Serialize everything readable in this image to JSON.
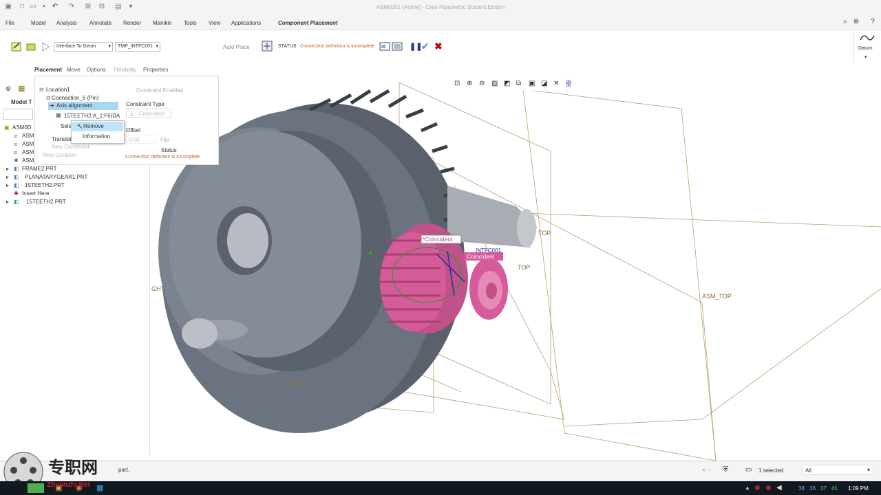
{
  "window": {
    "title": "ASM0001 (Active) - Creo Parametric Student Edition"
  },
  "menu": {
    "items": [
      "File",
      "Model",
      "Analysis",
      "Annotate",
      "Render",
      "Manikin",
      "Tools",
      "View",
      "Applications"
    ],
    "active": "Component Placement"
  },
  "ribbon": {
    "interface_dropdown": "Interface To Geom",
    "interface_value": "TMP_INTFC001",
    "auto_place": "Auto Place",
    "status_label": "STATUS",
    "status_text": "Connection definition is incomplete",
    "datum_label": "Datum"
  },
  "tabs": [
    "Placement",
    "Move",
    "Options",
    "Flexibility",
    "Properties"
  ],
  "panel": {
    "location": "Location1",
    "connection": "Connection_6 (Pin)",
    "axis_alignment": "Axis alignment",
    "reference": "15TEETH2:A_1:F6(DA",
    "select": "Sele",
    "translation": "Translati",
    "new_constraint": "New Constraint",
    "new_location": "New Location",
    "constraint_enabled": "Constraint Enabled",
    "constraint_type_label": "Constraint Type",
    "constraint_type_value": "Coincident",
    "offset_label": "Offset",
    "offset_value": "0.00",
    "flip": "Flip",
    "status_label": "Status",
    "status_text": "Connection definition is incomplete"
  },
  "context_menu": {
    "remove": "Remove",
    "information": "Information"
  },
  "tree": {
    "model_tab": "Model T",
    "root": "ASM0D",
    "items": [
      "ASM",
      "ASM",
      "ASM",
      "ASM"
    ],
    "parts": [
      "FRAME2.PRT",
      "PLANATARYGEAR1.PRT",
      "15TEETH2.PRT",
      "Insert Here",
      "15TEETH2.PRT"
    ]
  },
  "viewport": {
    "labels": {
      "top1": "TOP",
      "top2": "TOP",
      "asm_top": "ASM_TOP",
      "right1": "RIGHT",
      "right2": "GHT",
      "coincident1": "*Coincident",
      "coincident2": "Coincident",
      "intfc": "INTFC001"
    }
  },
  "statusbar": {
    "message": "part.",
    "selected": "1 selected",
    "filter": "All"
  },
  "taskbar": {
    "time": "1:09 PM",
    "nums": [
      "38",
      "36",
      "37",
      "41"
    ]
  },
  "watermark": {
    "brand": "专职网",
    "sub": "Zhuanzhi.Net"
  },
  "colors": {
    "accent": "#1a6fb5",
    "status_orange": "#c8641e",
    "pink": "#d65b9a",
    "gear": "#6b7380"
  }
}
